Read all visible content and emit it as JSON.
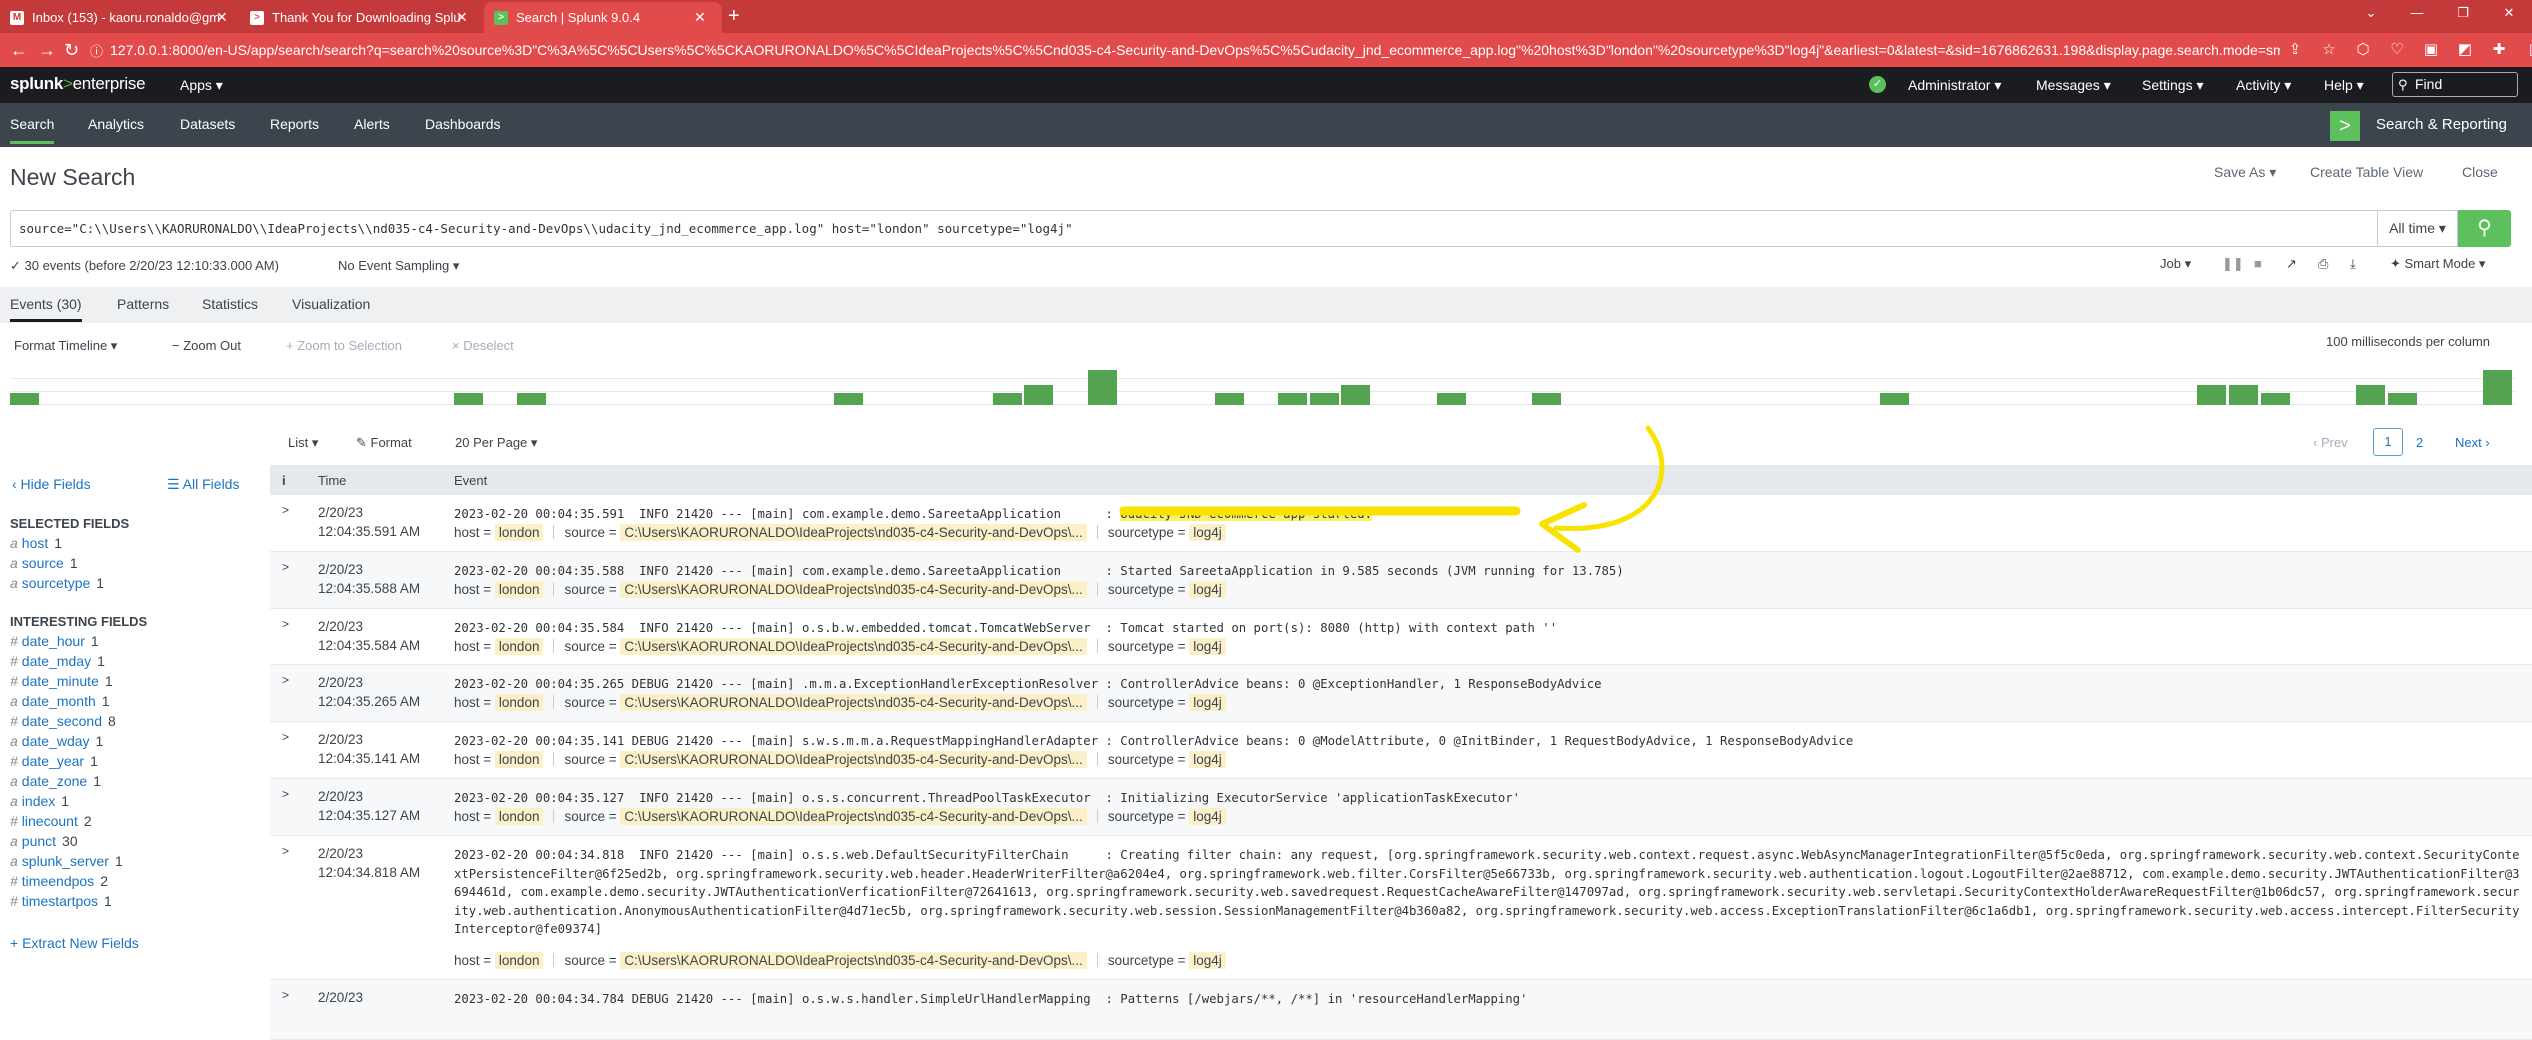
{
  "browser": {
    "tabs": [
      {
        "title": "Inbox (153) - kaoru.ronaldo@gm",
        "icon": "gmail-icon"
      },
      {
        "title": "Thank You for Downloading Splu",
        "icon": "splunk-tab-icon"
      },
      {
        "title": "Search | Splunk 9.0.4",
        "icon": "splunk-tab-icon"
      }
    ],
    "new_tab": "+",
    "url": "127.0.0.1:8000/en-US/app/search/search?q=search%20source%3D\"C%3A%5C%5CUsers%5C%5CKAORURONALDO%5C%5CIdeaProjects%5C%5Cnd035-c4-Security-and-DevOps%5C%5Cudacity_jnd_ecommerce_app.log\"%20host%3D\"london\"%20sourcetype%3D\"log4j\"&earliest=0&latest=&sid=1676862631.198&display.page.search.mode=smart..."
  },
  "splunk": {
    "logo_main": "splunk",
    "logo_gt": ">",
    "logo_sub": "enterprise",
    "apps": "Apps ▾",
    "admin": "Administrator ▾",
    "messages": "Messages ▾",
    "settings": "Settings ▾",
    "activity": "Activity ▾",
    "help": "Help ▾",
    "find": "Find",
    "nav": [
      "Search",
      "Analytics",
      "Datasets",
      "Reports",
      "Alerts",
      "Dashboards"
    ],
    "app_name": "Search & Reporting"
  },
  "search": {
    "title": "New Search",
    "save_as": "Save As ▾",
    "create_table": "Create Table View",
    "close": "Close",
    "query": "source=\"C:\\\\Users\\\\KAORURONALDO\\\\IdeaProjects\\\\nd035-c4-Security-and-DevOps\\\\udacity_jnd_ecommerce_app.log\" host=\"london\" sourcetype=\"log4j\"",
    "time_range": "All time ▾",
    "event_count": "✓ 30 events (before 2/20/23 12:10:33.000 AM)",
    "sampling": "No Event Sampling ▾",
    "job": "Job ▾",
    "mode": "Smart Mode ▾"
  },
  "tabs": [
    "Events (30)",
    "Patterns",
    "Statistics",
    "Visualization"
  ],
  "timeline_ctrl": {
    "format": "Format Timeline ▾",
    "zoom_out": "− Zoom Out",
    "zoom_sel": "+ Zoom to Selection",
    "deselect": "× Deselect",
    "unit": "100 milliseconds per column"
  },
  "timeline_bars": [
    {
      "col": 0,
      "v": 1
    },
    {
      "col": 14,
      "v": 1
    },
    {
      "col": 16,
      "v": 1
    },
    {
      "col": 26,
      "v": 1
    },
    {
      "col": 31,
      "v": 1
    },
    {
      "col": 32,
      "v": 2
    },
    {
      "col": 34,
      "v": 3
    },
    {
      "col": 38,
      "v": 1
    },
    {
      "col": 40,
      "v": 1
    },
    {
      "col": 41,
      "v": 1
    },
    {
      "col": 42,
      "v": 2
    },
    {
      "col": 45,
      "v": 1
    },
    {
      "col": 48,
      "v": 1
    },
    {
      "col": 59,
      "v": 1
    },
    {
      "col": 69,
      "v": 2
    },
    {
      "col": 70,
      "v": 2
    },
    {
      "col": 71,
      "v": 1
    },
    {
      "col": 74,
      "v": 2
    },
    {
      "col": 75,
      "v": 1
    },
    {
      "col": 78,
      "v": 3
    }
  ],
  "list_ctrl": {
    "list": "List ▾",
    "format": "✎ Format",
    "per_page": "20 Per Page ▾",
    "prev": "‹ Prev",
    "page1": "1",
    "page2": "2",
    "next": "Next ›"
  },
  "sidebar": {
    "hide": "‹ Hide Fields",
    "all": "☰ All Fields",
    "selected_head": "SELECTED FIELDS",
    "selected": [
      {
        "type": "a",
        "name": "host",
        "count": "1"
      },
      {
        "type": "a",
        "name": "source",
        "count": "1"
      },
      {
        "type": "a",
        "name": "sourcetype",
        "count": "1"
      }
    ],
    "interesting_head": "INTERESTING FIELDS",
    "interesting": [
      {
        "type": "#",
        "name": "date_hour",
        "count": "1"
      },
      {
        "type": "#",
        "name": "date_mday",
        "count": "1"
      },
      {
        "type": "#",
        "name": "date_minute",
        "count": "1"
      },
      {
        "type": "a",
        "name": "date_month",
        "count": "1"
      },
      {
        "type": "#",
        "name": "date_second",
        "count": "8"
      },
      {
        "type": "a",
        "name": "date_wday",
        "count": "1"
      },
      {
        "type": "#",
        "name": "date_year",
        "count": "1"
      },
      {
        "type": "a",
        "name": "date_zone",
        "count": "1"
      },
      {
        "type": "a",
        "name": "index",
        "count": "1"
      },
      {
        "type": "#",
        "name": "linecount",
        "count": "2"
      },
      {
        "type": "a",
        "name": "punct",
        "count": "30"
      },
      {
        "type": "a",
        "name": "splunk_server",
        "count": "1"
      },
      {
        "type": "#",
        "name": "timeendpos",
        "count": "2"
      },
      {
        "type": "#",
        "name": "timestartpos",
        "count": "1"
      }
    ],
    "extract": "+ Extract New Fields"
  },
  "table": {
    "col_i": "i",
    "col_time": "Time",
    "col_event": "Event",
    "meta_host_label": "host =",
    "meta_source_label": "source =",
    "meta_stype_label": "sourcetype =",
    "rows": [
      {
        "date": "2/20/23",
        "time": "12:04:35.591 AM",
        "text": "2023-02-20 00:04:35.591  INFO 21420 --- [main] com.example.demo.SareetaApplication      : ",
        "highlight": "Udacity JND ecommerce app started.",
        "host": "london",
        "source": "C:\\Users\\KAORURONALDO\\IdeaProjects\\nd035-c4-Security-and-DevOps\\...",
        "sourcetype": "log4j"
      },
      {
        "date": "2/20/23",
        "time": "12:04:35.588 AM",
        "text": "2023-02-20 00:04:35.588  INFO 21420 --- [main] com.example.demo.SareetaApplication      : Started SareetaApplication in 9.585 seconds (JVM running for 13.785)",
        "highlight": "",
        "host": "london",
        "source": "C:\\Users\\KAORURONALDO\\IdeaProjects\\nd035-c4-Security-and-DevOps\\...",
        "sourcetype": "log4j"
      },
      {
        "date": "2/20/23",
        "time": "12:04:35.584 AM",
        "text": "2023-02-20 00:04:35.584  INFO 21420 --- [main] o.s.b.w.embedded.tomcat.TomcatWebServer  : Tomcat started on port(s): 8080 (http) with context path ''",
        "highlight": "",
        "host": "london",
        "source": "C:\\Users\\KAORURONALDO\\IdeaProjects\\nd035-c4-Security-and-DevOps\\...",
        "sourcetype": "log4j"
      },
      {
        "date": "2/20/23",
        "time": "12:04:35.265 AM",
        "text": "2023-02-20 00:04:35.265 DEBUG 21420 --- [main] .m.m.a.ExceptionHandlerExceptionResolver : ControllerAdvice beans: 0 @ExceptionHandler, 1 ResponseBodyAdvice",
        "highlight": "",
        "host": "london",
        "source": "C:\\Users\\KAORURONALDO\\IdeaProjects\\nd035-c4-Security-and-DevOps\\...",
        "sourcetype": "log4j"
      },
      {
        "date": "2/20/23",
        "time": "12:04:35.141 AM",
        "text": "2023-02-20 00:04:35.141 DEBUG 21420 --- [main] s.w.s.m.m.a.RequestMappingHandlerAdapter : ControllerAdvice beans: 0 @ModelAttribute, 0 @InitBinder, 1 RequestBodyAdvice, 1 ResponseBodyAdvice",
        "highlight": "",
        "host": "london",
        "source": "C:\\Users\\KAORURONALDO\\IdeaProjects\\nd035-c4-Security-and-DevOps\\...",
        "sourcetype": "log4j"
      },
      {
        "date": "2/20/23",
        "time": "12:04:35.127 AM",
        "text": "2023-02-20 00:04:35.127  INFO 21420 --- [main] o.s.s.concurrent.ThreadPoolTaskExecutor  : Initializing ExecutorService 'applicationTaskExecutor'",
        "highlight": "",
        "host": "london",
        "source": "C:\\Users\\KAORURONALDO\\IdeaProjects\\nd035-c4-Security-and-DevOps\\...",
        "sourcetype": "log4j"
      },
      {
        "date": "2/20/23",
        "time": "12:04:34.818 AM",
        "text": "2023-02-20 00:04:34.818  INFO 21420 --- [main] o.s.s.web.DefaultSecurityFilterChain     : Creating filter chain: any request, [org.springframework.security.web.context.request.async.WebAsyncManagerIntegrationFilter@5f5c0eda, org.springframework.security.web.context.SecurityContextPersistenceFilter@6f25ed2b, org.springframework.security.web.header.HeaderWriterFilter@a6204e4, org.springframework.web.filter.CorsFilter@5e66733b, org.springframework.security.web.authentication.logout.LogoutFilter@2ae88712, com.example.demo.security.JWTAuthenticationFilter@3694461d, com.example.demo.security.JWTAuthenticationVerficationFilter@72641613, org.springframework.security.web.savedrequest.RequestCacheAwareFilter@147097ad, org.springframework.security.web.servletapi.SecurityContextHolderAwareRequestFilter@1b06dc57, org.springframework.security.web.authentication.AnonymousAuthenticationFilter@4d71ec5b, org.springframework.security.web.session.SessionManagementFilter@4b360a82, org.springframework.security.web.access.ExceptionTranslationFilter@6c1a6db1, org.springframework.security.web.access.intercept.FilterSecurityInterceptor@fe09374]",
        "highlight": "",
        "host": "london",
        "source": "C:\\Users\\KAORURONALDO\\IdeaProjects\\nd035-c4-Security-and-DevOps\\...",
        "sourcetype": "log4j"
      },
      {
        "date": "2/20/23",
        "time": "",
        "text": "2023-02-20 00:04:34.784 DEBUG 21420 --- [main] o.s.w.s.handler.SimpleUrlHandlerMapping  : Patterns [/webjars/**, /**] in 'resourceHandlerMapping'",
        "highlight": "",
        "host": "",
        "source": "",
        "sourcetype": ""
      }
    ]
  },
  "colors": {
    "browser_red": "#e24b4b",
    "splunk_green": "#5cc05c",
    "annotation_yellow": "#f8e300"
  }
}
